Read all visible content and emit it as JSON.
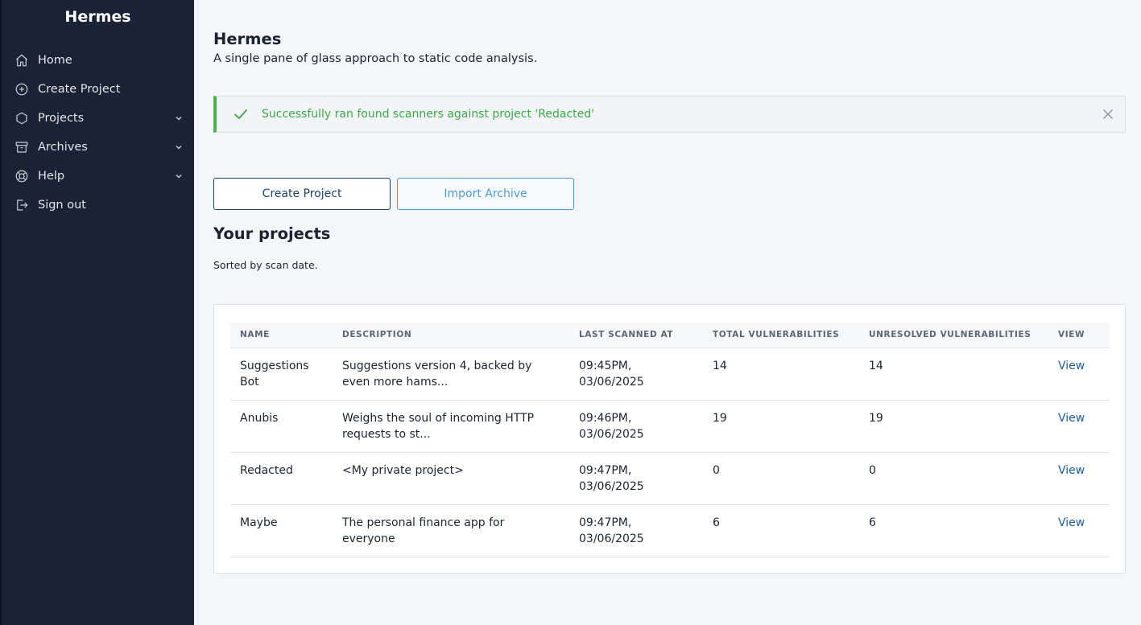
{
  "app": {
    "brand": "Hermes"
  },
  "sidebar": {
    "items": [
      {
        "label": "Home",
        "icon": "home-icon",
        "expandable": false
      },
      {
        "label": "Create Project",
        "icon": "plus-circle-icon",
        "expandable": false
      },
      {
        "label": "Projects",
        "icon": "cube-icon",
        "expandable": true
      },
      {
        "label": "Archives",
        "icon": "archive-icon",
        "expandable": true
      },
      {
        "label": "Help",
        "icon": "lifebuoy-icon",
        "expandable": true
      },
      {
        "label": "Sign out",
        "icon": "sign-out-icon",
        "expandable": false
      }
    ]
  },
  "header": {
    "title": "Hermes",
    "subtitle": "A single pane of glass approach to static code analysis."
  },
  "alert": {
    "message": "Successfully ran found scanners against project 'Redacted'",
    "status_color": "#3aa845"
  },
  "actions": {
    "create_label": "Create Project",
    "import_label": "Import Archive"
  },
  "projects": {
    "title": "Your projects",
    "note": "Sorted by scan date.",
    "columns": [
      "NAME",
      "DESCRIPTION",
      "LAST SCANNED AT",
      "TOTAL VULNERABILITIES",
      "UNRESOLVED VULNERABILITIES",
      "VIEW"
    ],
    "rows": [
      {
        "name": "Suggestions Bot",
        "description": "Suggestions version 4, backed by even more hams...",
        "scanned_time": "09:45PM,",
        "scanned_date": "03/06/2025",
        "total": "14",
        "unresolved": "14",
        "view": "View"
      },
      {
        "name": "Anubis",
        "description": "Weighs the soul of incoming HTTP requests to st...",
        "scanned_time": "09:46PM,",
        "scanned_date": "03/06/2025",
        "total": "19",
        "unresolved": "19",
        "view": "View"
      },
      {
        "name": "Redacted",
        "description": "<My private project>",
        "scanned_time": "09:47PM,",
        "scanned_date": "03/06/2025",
        "total": "0",
        "unresolved": "0",
        "view": "View"
      },
      {
        "name": "Maybe",
        "description": "The personal finance app for everyone",
        "scanned_time": "09:47PM,",
        "scanned_date": "03/06/2025",
        "total": "6",
        "unresolved": "6",
        "view": "View"
      }
    ]
  }
}
